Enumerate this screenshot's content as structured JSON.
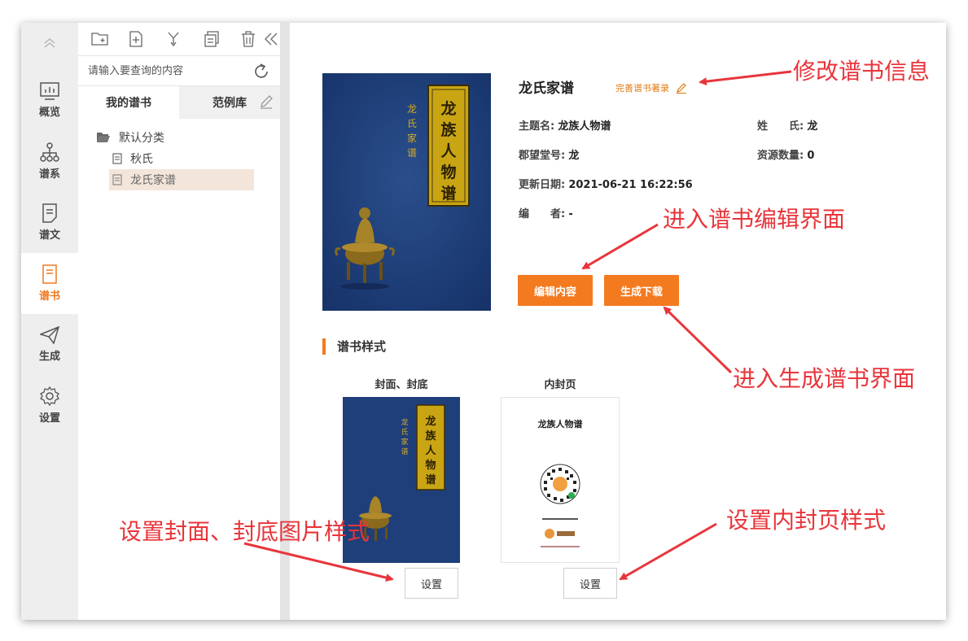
{
  "nav": {
    "items": [
      {
        "label": "概览",
        "icon": "chart-icon"
      },
      {
        "label": "谱系",
        "icon": "tree-structure-icon"
      },
      {
        "label": "谱文",
        "icon": "document-icon"
      },
      {
        "label": "谱书",
        "icon": "book-icon",
        "active": true
      },
      {
        "label": "生成",
        "icon": "paper-plane-icon"
      },
      {
        "label": "设置",
        "icon": "gear-icon"
      }
    ]
  },
  "tree": {
    "search_placeholder": "请输入要查询的内容",
    "tabs": [
      "我的谱书",
      "范例库"
    ],
    "category": "默认分类",
    "books": [
      "秋氏",
      "龙氏家谱"
    ]
  },
  "book": {
    "title": "龙氏家谱",
    "complete_link": "完善谱书著录",
    "cover_side_text": "龙氏家谱",
    "cover_main_text": "龙族人物谱",
    "fields": {
      "subject_label": "主题名:",
      "subject_value": "龙族人物谱",
      "surname_label": "姓　　氏:",
      "surname_value": "龙",
      "hall_label": "郡望堂号:",
      "hall_value": "龙",
      "resources_label": "资源数量:",
      "resources_value": "0",
      "date_label": "更新日期:",
      "date_value": "2021-06-21 16:22:56",
      "editor_label": "编　　者:",
      "editor_value": "-"
    },
    "edit_button": "编辑内容",
    "generate_button": "生成下载"
  },
  "styles": {
    "section_title": "谱书样式",
    "cover_caption": "封面、封底",
    "inner_caption": "内封页",
    "inner_title": "龙族人物谱",
    "set_label": "设置"
  },
  "annotations": {
    "edit_info": "修改谱书信息",
    "enter_edit": "进入谱书编辑界面",
    "enter_generate": "进入生成谱书界面",
    "set_cover": "设置封面、封底图片样式",
    "set_inner": "设置内封页样式"
  },
  "colors": {
    "accent": "#f47a1f",
    "annotation": "#e8353b",
    "cover_blue": "#1f3f7a",
    "label_gold": "#c9a514"
  }
}
